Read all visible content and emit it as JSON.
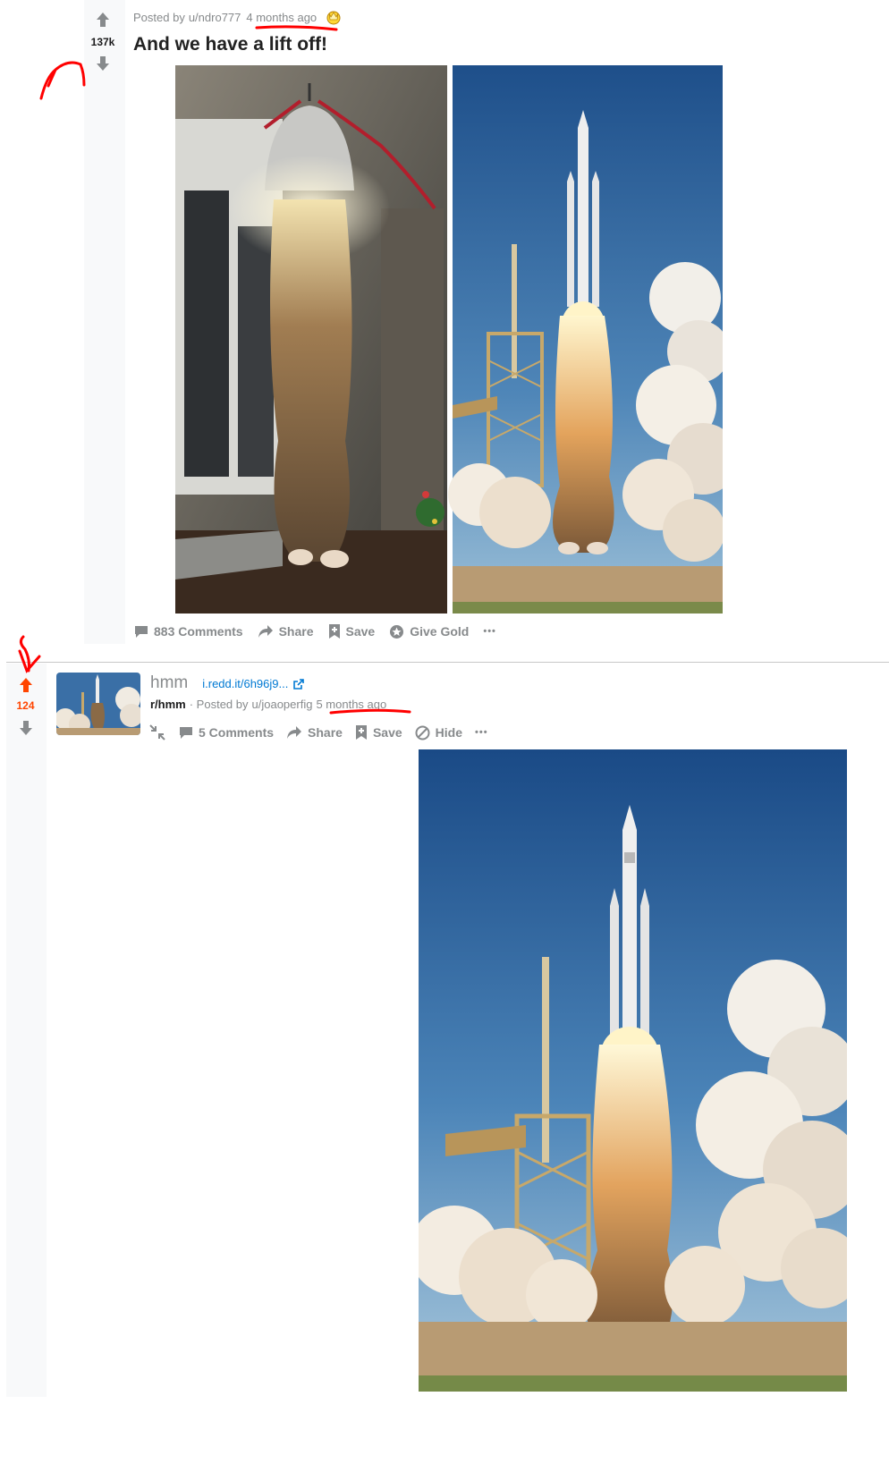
{
  "post1": {
    "posted_by_prefix": "Posted by",
    "author": "u/ndro777",
    "time": "4 months ago",
    "award_icon": "gold-award-icon",
    "score": "137k",
    "title": "And we have a lift off!",
    "actions": {
      "comments": "883 Comments",
      "share": "Share",
      "save": "Save",
      "give_gold": "Give Gold",
      "more": "•••"
    }
  },
  "post2": {
    "score": "124",
    "title": "hmm",
    "domain": "i.redd.it/6h96j9...",
    "subreddit": "r/hmm",
    "posted_by_prefix": "· Posted by",
    "author": "u/joaoperfig",
    "time": "5 months ago",
    "actions": {
      "comments": "5 Comments",
      "share": "Share",
      "save": "Save",
      "hide": "Hide",
      "more": "•••"
    }
  },
  "colors": {
    "upvote_active": "#ff4500",
    "muted": "#878a8c",
    "link": "#0079d3",
    "annotation": "#ff0000"
  }
}
